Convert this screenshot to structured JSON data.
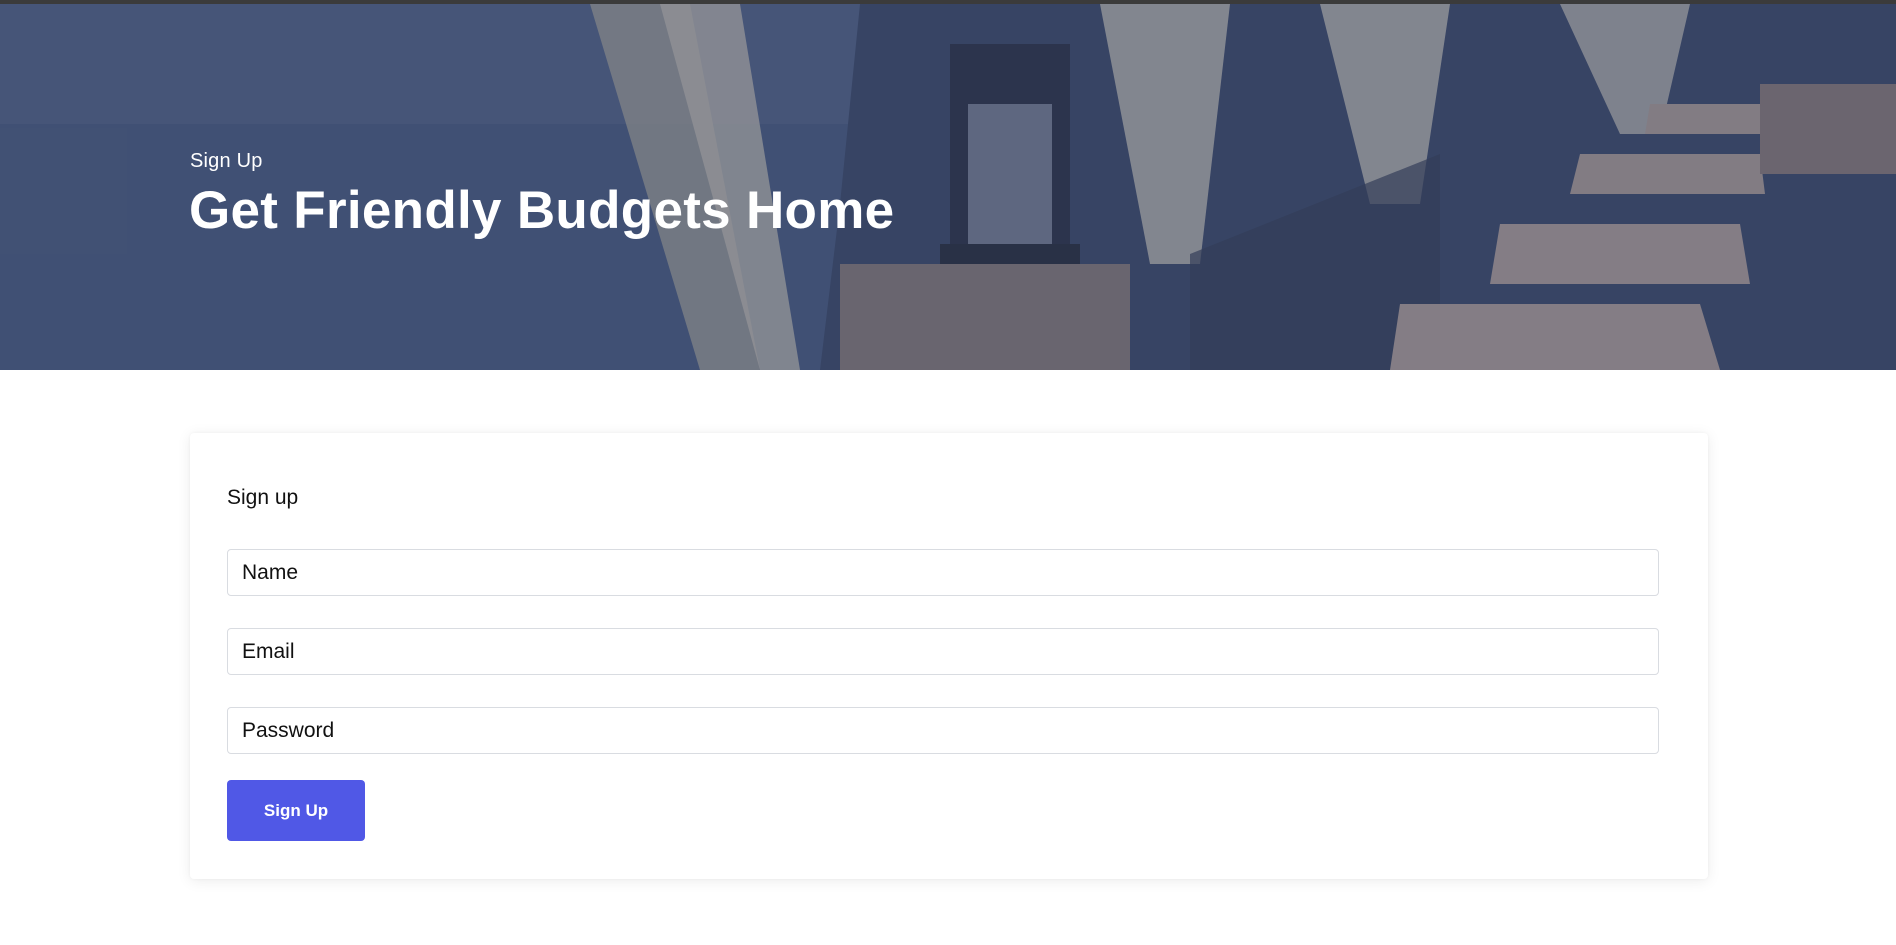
{
  "hero": {
    "subtitle": "Sign Up",
    "title": "Get Friendly Budgets Home",
    "image": "restaurant-terrace-sea-view"
  },
  "form": {
    "heading": "Sign up",
    "name_placeholder": "Name",
    "email_placeholder": "Email",
    "password_placeholder": "Password",
    "submit_label": "Sign Up"
  },
  "colors": {
    "accent": "#5058e6",
    "hero_overlay": "#28375f",
    "input_border": "#d9dce1"
  }
}
